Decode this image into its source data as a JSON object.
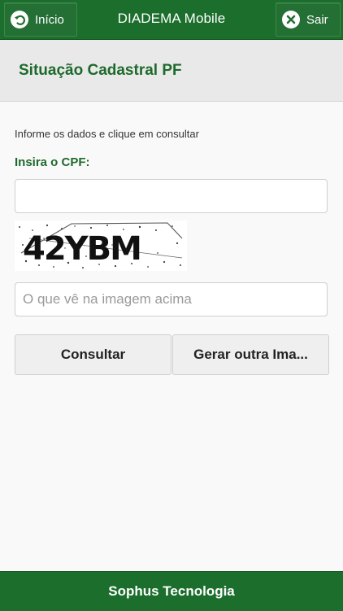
{
  "header": {
    "title": "DIADEMA Mobile",
    "back_label": "Início",
    "exit_label": "Sair"
  },
  "page": {
    "title": "Situação Cadastral PF"
  },
  "form": {
    "instruction": "Informe os dados e clique em consultar",
    "cpf_label": "Insira o CPF:",
    "cpf_value": "",
    "captcha_text": "42YBM",
    "captcha_placeholder": "O que vê na imagem acima",
    "captcha_value": "",
    "consult_label": "Consultar",
    "regenerate_label": "Gerar outra Ima..."
  },
  "footer": {
    "text": "Sophus Tecnologia"
  },
  "colors": {
    "brand_green": "#1b6e2c",
    "title_green": "#1e6a2c",
    "subheader_bg": "#e9e9e9",
    "page_bg": "#f9f9f9"
  },
  "icons": {
    "back": "back-arrow-icon",
    "exit": "close-x-icon"
  }
}
